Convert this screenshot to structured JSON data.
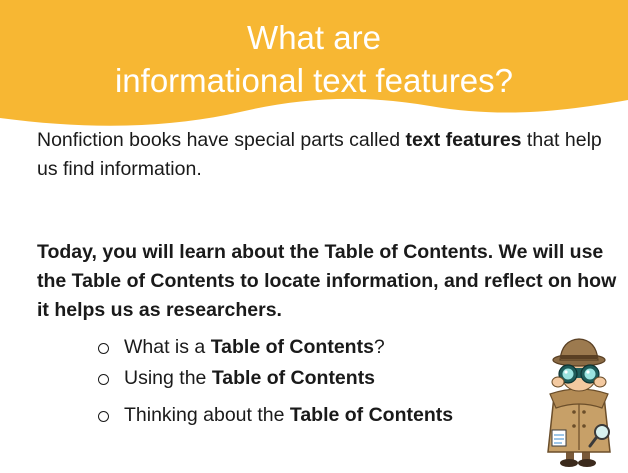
{
  "title": {
    "line1": "What are",
    "line2": "informational text features?"
  },
  "intro": {
    "text_before": "Nonfiction books have special parts called ",
    "bold": "text features",
    "text_after": " that help us find information."
  },
  "goal": "Today, you will learn about the Table of Contents. We will use the Table of Contents to locate information, and reflect on how it helps us as researchers.",
  "bullets": [
    {
      "prefix": "What is a ",
      "bold": "Table of Contents",
      "suffix": "?"
    },
    {
      "prefix": "Using the ",
      "bold": "Table of Contents",
      "suffix": ""
    },
    {
      "prefix": "Thinking about the ",
      "bold": "Table of Contents",
      "suffix": ""
    }
  ],
  "colors": {
    "banner": "#f7b733",
    "title_text": "#ffffff",
    "body_text": "#1a1a1a"
  },
  "icons": {
    "clipart": "detective-with-binoculars-icon"
  }
}
